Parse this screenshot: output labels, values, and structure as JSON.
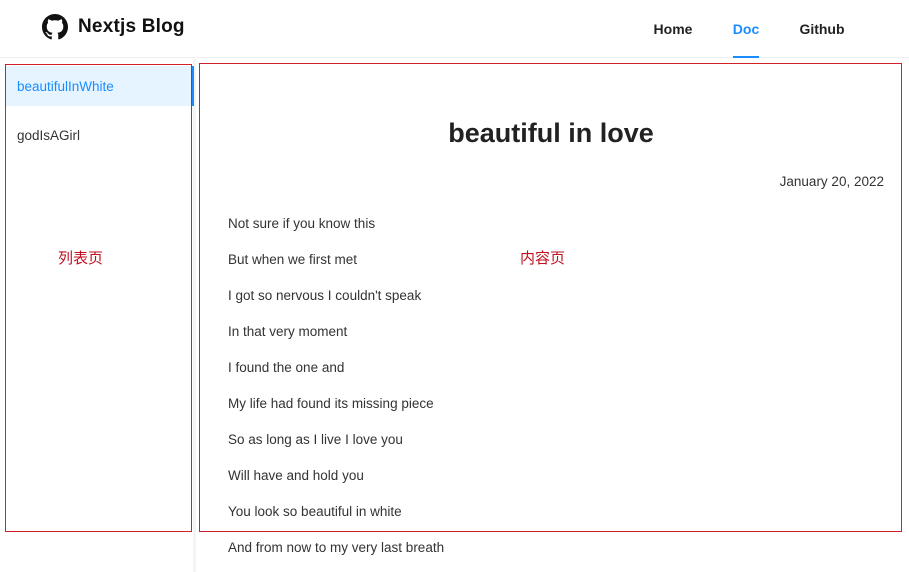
{
  "header": {
    "title": "Nextjs Blog",
    "logo_icon": "github-icon",
    "nav": [
      {
        "label": "Home",
        "active": false
      },
      {
        "label": "Doc",
        "active": true
      },
      {
        "label": "Github",
        "active": false
      }
    ]
  },
  "sidebar": {
    "items": [
      {
        "label": "beautifulInWhite",
        "active": true
      },
      {
        "label": "godIsAGirl",
        "active": false
      }
    ]
  },
  "annotations": {
    "list_label": "列表页",
    "content_label": "内容页",
    "color": "#d0202a"
  },
  "article": {
    "title": "beautiful in love",
    "date": "January 20, 2022",
    "lines": [
      "Not sure if you know this",
      "But when we first met",
      "I got so nervous I couldn't speak",
      "In that very moment",
      "I found the one and",
      "My life had found its missing piece",
      "So as long as I live I love you",
      "Will have and hold you",
      "You look so beautiful in white",
      "And from now to my very last breath"
    ]
  },
  "colors": {
    "accent": "#1a8cff",
    "active_bg": "#e6f4ff"
  }
}
